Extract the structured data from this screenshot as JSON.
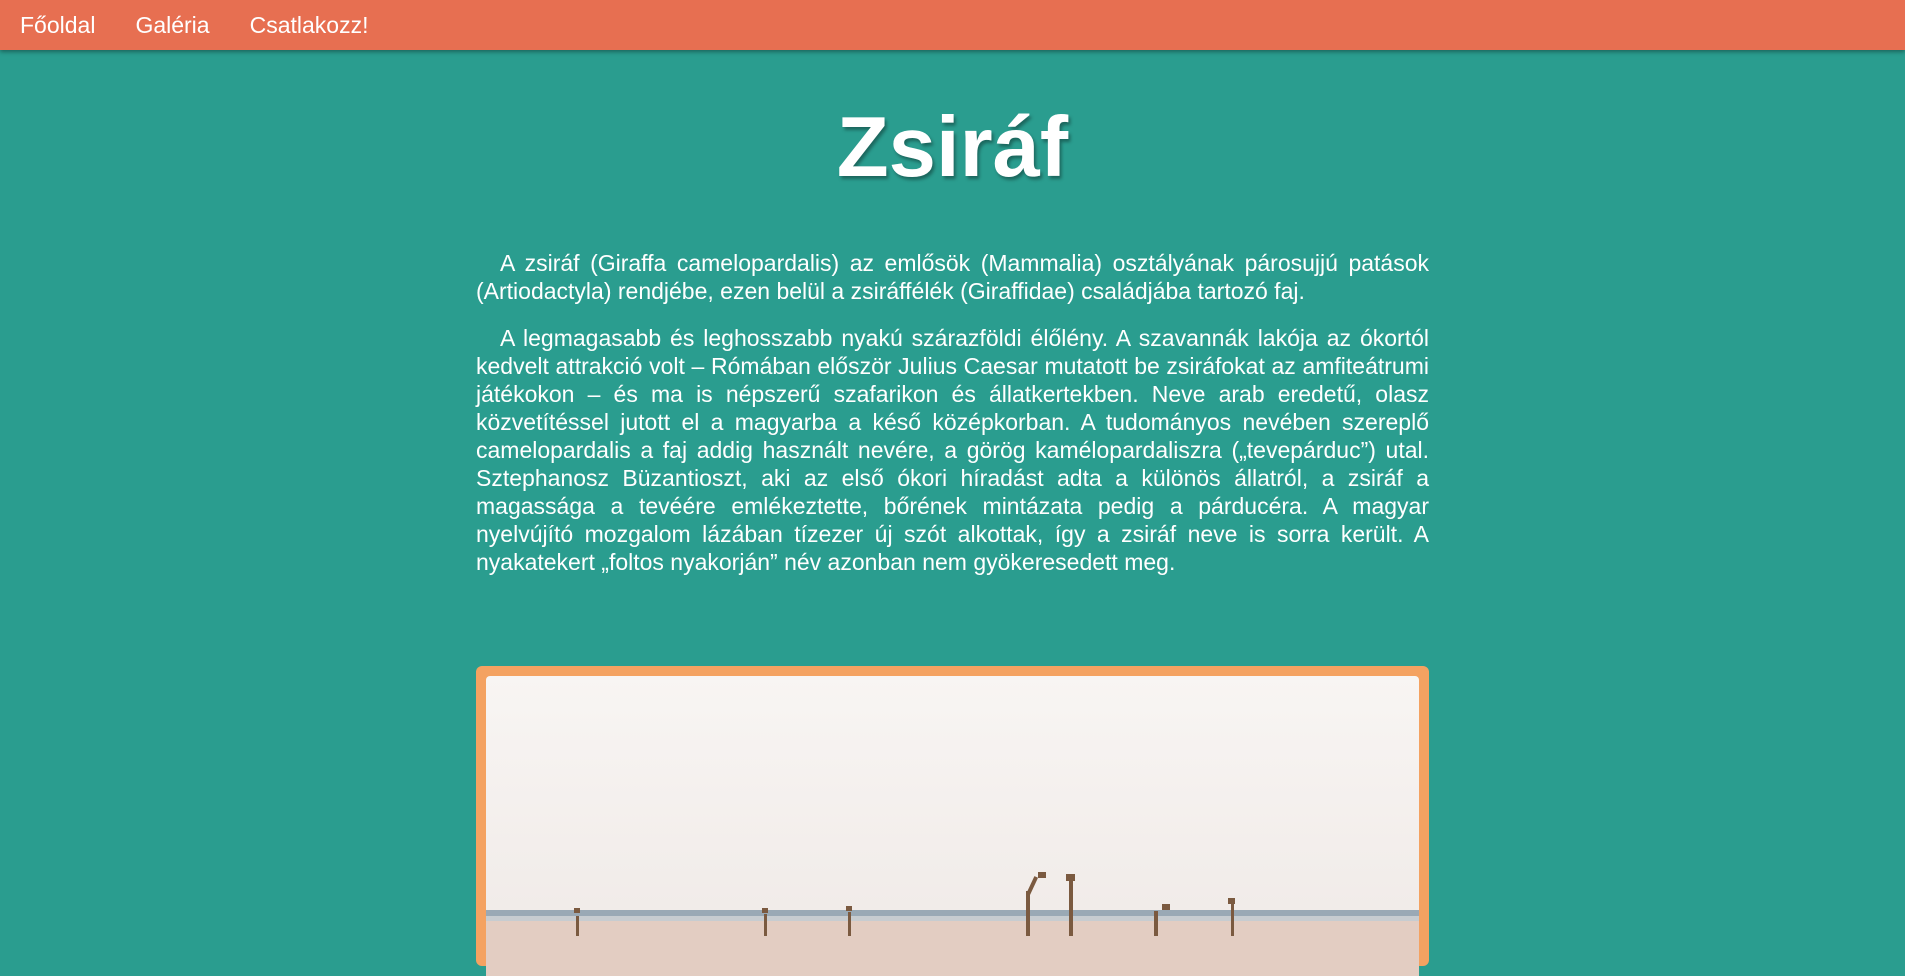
{
  "nav": {
    "items": [
      {
        "label": "Főoldal"
      },
      {
        "label": "Galéria"
      },
      {
        "label": "Csatlakozz!"
      }
    ]
  },
  "page": {
    "title": "Zsiráf",
    "paragraphs": [
      "A zsiráf (Giraffa camelopardalis) az emlősök (Mammalia) osztályának párosujjú patások (Artiodactyla) rendjébe, ezen belül a zsiráffélék (Giraffidae) családjába tartozó faj.",
      "A legmagasabb és leghosszabb nyakú szárazföldi élőlény. A szavannák lakója az ókortól kedvelt attrakció volt – Rómában először Julius Caesar mutatott be zsiráfokat az amfiteátrumi játékokon – és ma is népszerű szafarikon és állatkertekben. Neve arab eredetű, olasz közvetítéssel jutott el a magyarba a késő középkorban. A tudományos nevében szereplő camelopardalis a faj addig használt nevére, a görög kamélopardaliszra („tevepárduc”) utal. Sztephanosz Büzantioszt, aki az első ókori híradást adta a különös állatról, a zsiráf a magassága a tevéére emlékeztette, bőrének mintázata pedig a párducéra. A magyar nyelvújító mozgalom lázában tízezer új szót alkottak, így a zsiráf neve is sorra került. A nyakatekert „foltos nyakorján” név azonban nem gyökeresedett meg."
    ]
  },
  "colors": {
    "background": "#2a9d8f",
    "navbar": "#e76f51",
    "frame": "#f4a261"
  }
}
